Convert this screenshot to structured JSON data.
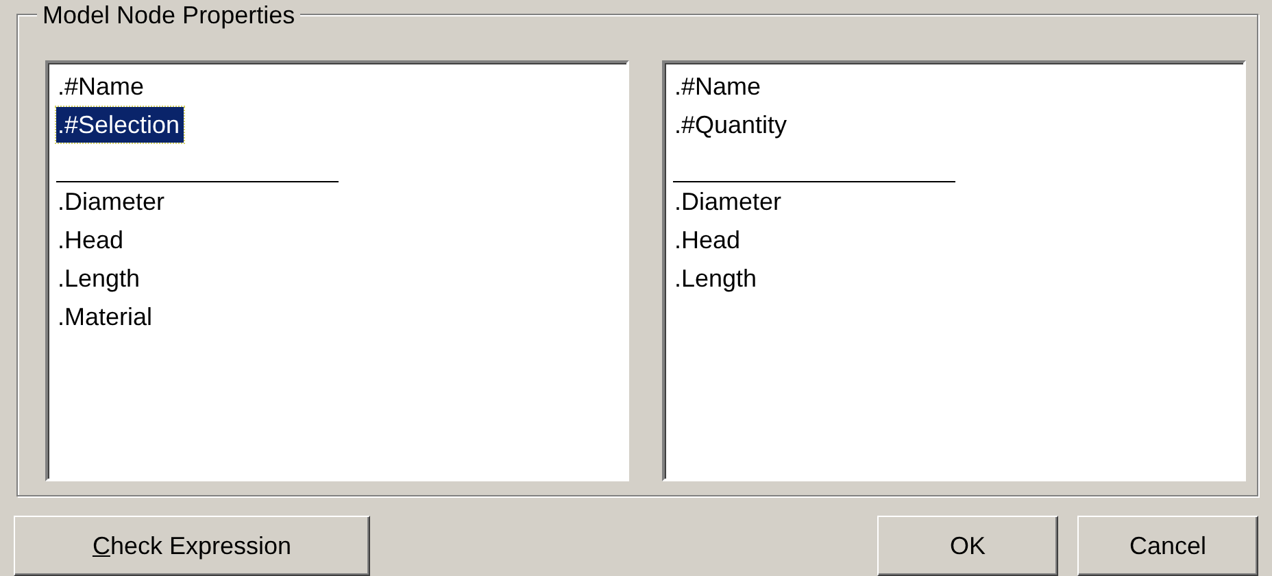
{
  "group": {
    "title": "Model Node Properties"
  },
  "lists": [
    {
      "items": [
        {
          "kind": "item",
          "text": ".#Name",
          "selected": false
        },
        {
          "kind": "item",
          "text": ".#Selection",
          "selected": true
        },
        {
          "kind": "separator"
        },
        {
          "kind": "item",
          "text": ".Diameter",
          "selected": false
        },
        {
          "kind": "item",
          "text": ".Head",
          "selected": false
        },
        {
          "kind": "item",
          "text": ".Length",
          "selected": false
        },
        {
          "kind": "item",
          "text": ".Material",
          "selected": false
        }
      ]
    },
    {
      "items": [
        {
          "kind": "item",
          "text": ".#Name",
          "selected": false
        },
        {
          "kind": "item",
          "text": ".#Quantity",
          "selected": false
        },
        {
          "kind": "separator"
        },
        {
          "kind": "item",
          "text": ".Diameter",
          "selected": false
        },
        {
          "kind": "item",
          "text": ".Head",
          "selected": false
        },
        {
          "kind": "item",
          "text": ".Length",
          "selected": false
        }
      ]
    }
  ],
  "buttons": [
    {
      "mnemonic": "C",
      "label": "heck Expression"
    },
    {
      "label": "OK"
    },
    {
      "label": "Cancel"
    }
  ]
}
